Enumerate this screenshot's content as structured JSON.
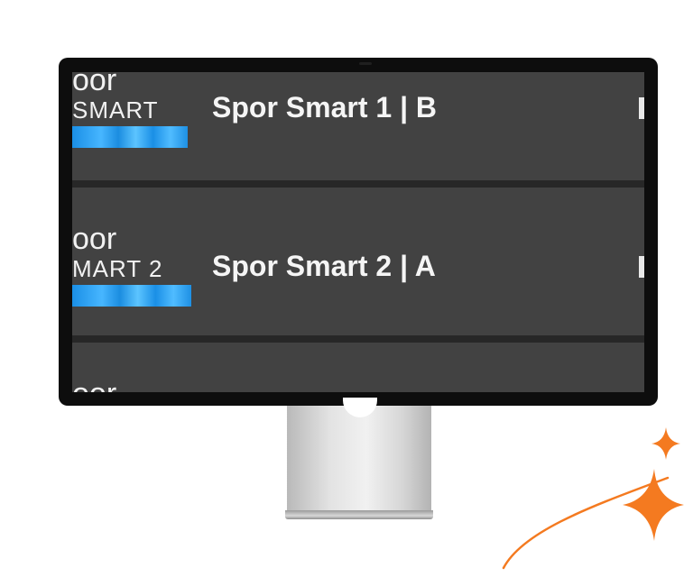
{
  "channels": [
    {
      "logo_top": "oor",
      "logo_mid": "SMART",
      "name": "Spor Smart 1 | B"
    },
    {
      "logo_top": "oor",
      "logo_mid": "MART 2",
      "name": "Spor Smart 2 | A"
    },
    {
      "logo_top": "oor"
    }
  ],
  "colors": {
    "screen_bg": "#424242",
    "divider": "#272727",
    "logo_bar": "#2a9bf0",
    "sparkle": "#f47a20"
  },
  "icons": {
    "decoration": "sparkle-star-icon"
  }
}
